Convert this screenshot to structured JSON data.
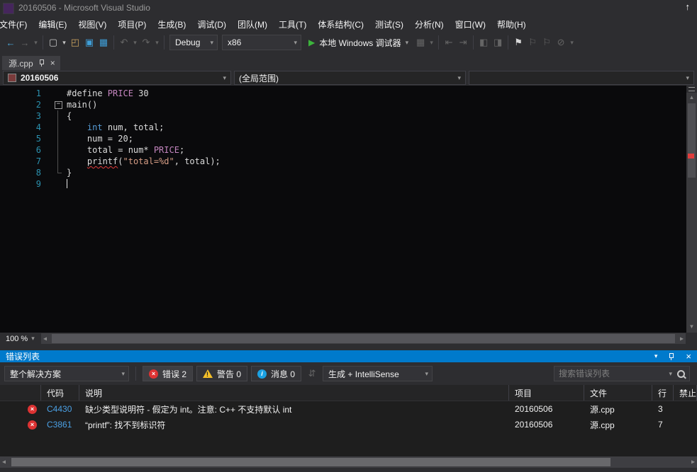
{
  "colors": {
    "accent": "#007acc",
    "error": "#dd3333",
    "warning": "#f4bf28",
    "info": "#1ba1e2"
  },
  "glyphs": {
    "close": "×",
    "chevron_down": "▾",
    "play": "▶",
    "up_arrow": "↑",
    "scroll_up": "▲",
    "scroll_down": "▼",
    "scroll_left": "◂",
    "scroll_right": "▸",
    "fold_collapse": "−",
    "error_x": "×",
    "info_i": "i",
    "sort": "⇵"
  },
  "window": {
    "title": "20160506 - Microsoft Visual Studio"
  },
  "menu_items": [
    "文件(F)",
    "编辑(E)",
    "视图(V)",
    "项目(P)",
    "生成(B)",
    "调试(D)",
    "团队(M)",
    "工具(T)",
    "体系结构(C)",
    "测试(S)",
    "分析(N)",
    "窗口(W)",
    "帮助(H)"
  ],
  "toolbar": {
    "items": [
      {
        "kind": "icon",
        "name": "back-icon",
        "glyph": "←",
        "color": "#4aa7d8"
      },
      {
        "kind": "icon",
        "name": "forward-icon",
        "glyph": "→",
        "dim": true
      },
      {
        "kind": "icon",
        "name": "navigation-history-dropdown-icon",
        "glyph": "▾",
        "dim": true,
        "small": true
      },
      {
        "kind": "sep"
      },
      {
        "kind": "icon",
        "name": "new-file-icon",
        "glyph": "▢"
      },
      {
        "kind": "icon",
        "name": "new-file-dropdown-icon",
        "glyph": "▾",
        "small": true
      },
      {
        "kind": "icon",
        "name": "open-file-icon",
        "glyph": "◰",
        "color": "#caa35f"
      },
      {
        "kind": "icon",
        "name": "save-icon",
        "glyph": "▣",
        "color": "#3f9fd8"
      },
      {
        "kind": "icon",
        "name": "save-all-icon",
        "glyph": "▦",
        "color": "#3f9fd8"
      },
      {
        "kind": "sep"
      },
      {
        "kind": "icon",
        "name": "undo-icon",
        "glyph": "↶",
        "dim": true
      },
      {
        "kind": "icon",
        "name": "undo-dropdown-icon",
        "glyph": "▾",
        "dim": true,
        "small": true
      },
      {
        "kind": "icon",
        "name": "redo-icon",
        "glyph": "↷",
        "dim": true
      },
      {
        "kind": "icon",
        "name": "redo-dropdown-icon",
        "glyph": "▾",
        "dim": true,
        "small": true
      },
      {
        "kind": "sep"
      },
      {
        "kind": "combo",
        "name": "solution-configuration-combo",
        "value": "Debug",
        "width": 68
      },
      {
        "kind": "combo",
        "name": "solution-platform-combo",
        "value": "x86",
        "width": 112
      },
      {
        "kind": "run",
        "name": "start-debugging-button",
        "label": "本地 Windows 调试器"
      },
      {
        "kind": "icon",
        "name": "attach-to-process-icon",
        "glyph": "▦",
        "dim": true
      },
      {
        "kind": "icon",
        "name": "attach-dropdown-icon",
        "glyph": "▾",
        "dim": true,
        "small": true
      },
      {
        "kind": "sep"
      },
      {
        "kind": "icon",
        "name": "navigate-backward-document-icon",
        "glyph": "⇤",
        "dim": true
      },
      {
        "kind": "icon",
        "name": "navigate-forward-document-icon",
        "glyph": "⇥",
        "dim": true
      },
      {
        "kind": "sep"
      },
      {
        "kind": "icon",
        "name": "indent-decrease-icon",
        "glyph": "◧",
        "dim": true
      },
      {
        "kind": "icon",
        "name": "indent-increase-icon",
        "glyph": "◨",
        "dim": true
      },
      {
        "kind": "sep"
      },
      {
        "kind": "icon",
        "name": "toggle-bookmark-icon",
        "glyph": "⚑",
        "color": "#d8d8d8"
      },
      {
        "kind": "icon",
        "name": "previous-bookmark-icon",
        "glyph": "⚐",
        "dim": true
      },
      {
        "kind": "icon",
        "name": "next-bookmark-icon",
        "glyph": "⚐",
        "dim": true
      },
      {
        "kind": "icon",
        "name": "clear-bookmarks-icon",
        "glyph": "⊘",
        "dim": true
      },
      {
        "kind": "icon",
        "name": "toolbar-options-dropdown-icon",
        "glyph": "▾",
        "dim": true,
        "small": true
      }
    ]
  },
  "tab": {
    "label": "源.cpp"
  },
  "navbar": {
    "type_value": "20160506",
    "scope_value": "(全局范围)",
    "member_value": ""
  },
  "editor": {
    "zoom_value": "100 %",
    "lines": [
      {
        "num": 1,
        "segments": [
          [
            "pp",
            "#define "
          ],
          [
            "macro",
            "PRICE"
          ],
          [
            "plain",
            " 30"
          ]
        ]
      },
      {
        "num": 2,
        "fold": true,
        "segments": [
          [
            "plain",
            "main()"
          ]
        ]
      },
      {
        "num": 3,
        "guide": true,
        "segments": [
          [
            "plain",
            "{"
          ]
        ]
      },
      {
        "num": 4,
        "guide": true,
        "segments": [
          [
            "plain",
            "    "
          ],
          [
            "kw",
            "int"
          ],
          [
            "plain",
            " num, total;"
          ]
        ]
      },
      {
        "num": 5,
        "guide": true,
        "segments": [
          [
            "plain",
            "    num = 20;"
          ]
        ]
      },
      {
        "num": 6,
        "guide": true,
        "segments": [
          [
            "plain",
            "    total = num* "
          ],
          [
            "macro",
            "PRICE"
          ],
          [
            "plain",
            ";"
          ]
        ]
      },
      {
        "num": 7,
        "guide": true,
        "segments": [
          [
            "plain",
            "    "
          ],
          [
            "err",
            "printf"
          ],
          [
            "plain",
            "("
          ],
          [
            "str",
            "\"total=%d\""
          ],
          [
            "plain",
            ", total);"
          ]
        ]
      },
      {
        "num": 8,
        "guide": "end",
        "segments": [
          [
            "plain",
            "}"
          ]
        ]
      },
      {
        "num": 9,
        "caret": true,
        "segments": []
      }
    ]
  },
  "error_list": {
    "title": "错误列表",
    "scope_value": "整个解决方案",
    "errors_label": "错误 2",
    "warnings_label": "警告 0",
    "messages_label": "消息 0",
    "source_value": "生成 + IntelliSense",
    "search_placeholder": "搜索错误列表",
    "columns": {
      "code": "代码",
      "description": "说明",
      "project": "项目",
      "file": "文件",
      "line": "行",
      "suppression": "禁止显示状态"
    },
    "rows": [
      {
        "severity": "error",
        "code": "C4430",
        "description": "缺少类型说明符 - 假定为 int。注意: C++ 不支持默认 int",
        "project": "20160506",
        "file": "源.cpp",
        "line": "3",
        "suppression": ""
      },
      {
        "severity": "error",
        "code": "C3861",
        "description": "“printf”: 找不到标识符",
        "project": "20160506",
        "file": "源.cpp",
        "line": "7",
        "suppression": ""
      }
    ]
  }
}
